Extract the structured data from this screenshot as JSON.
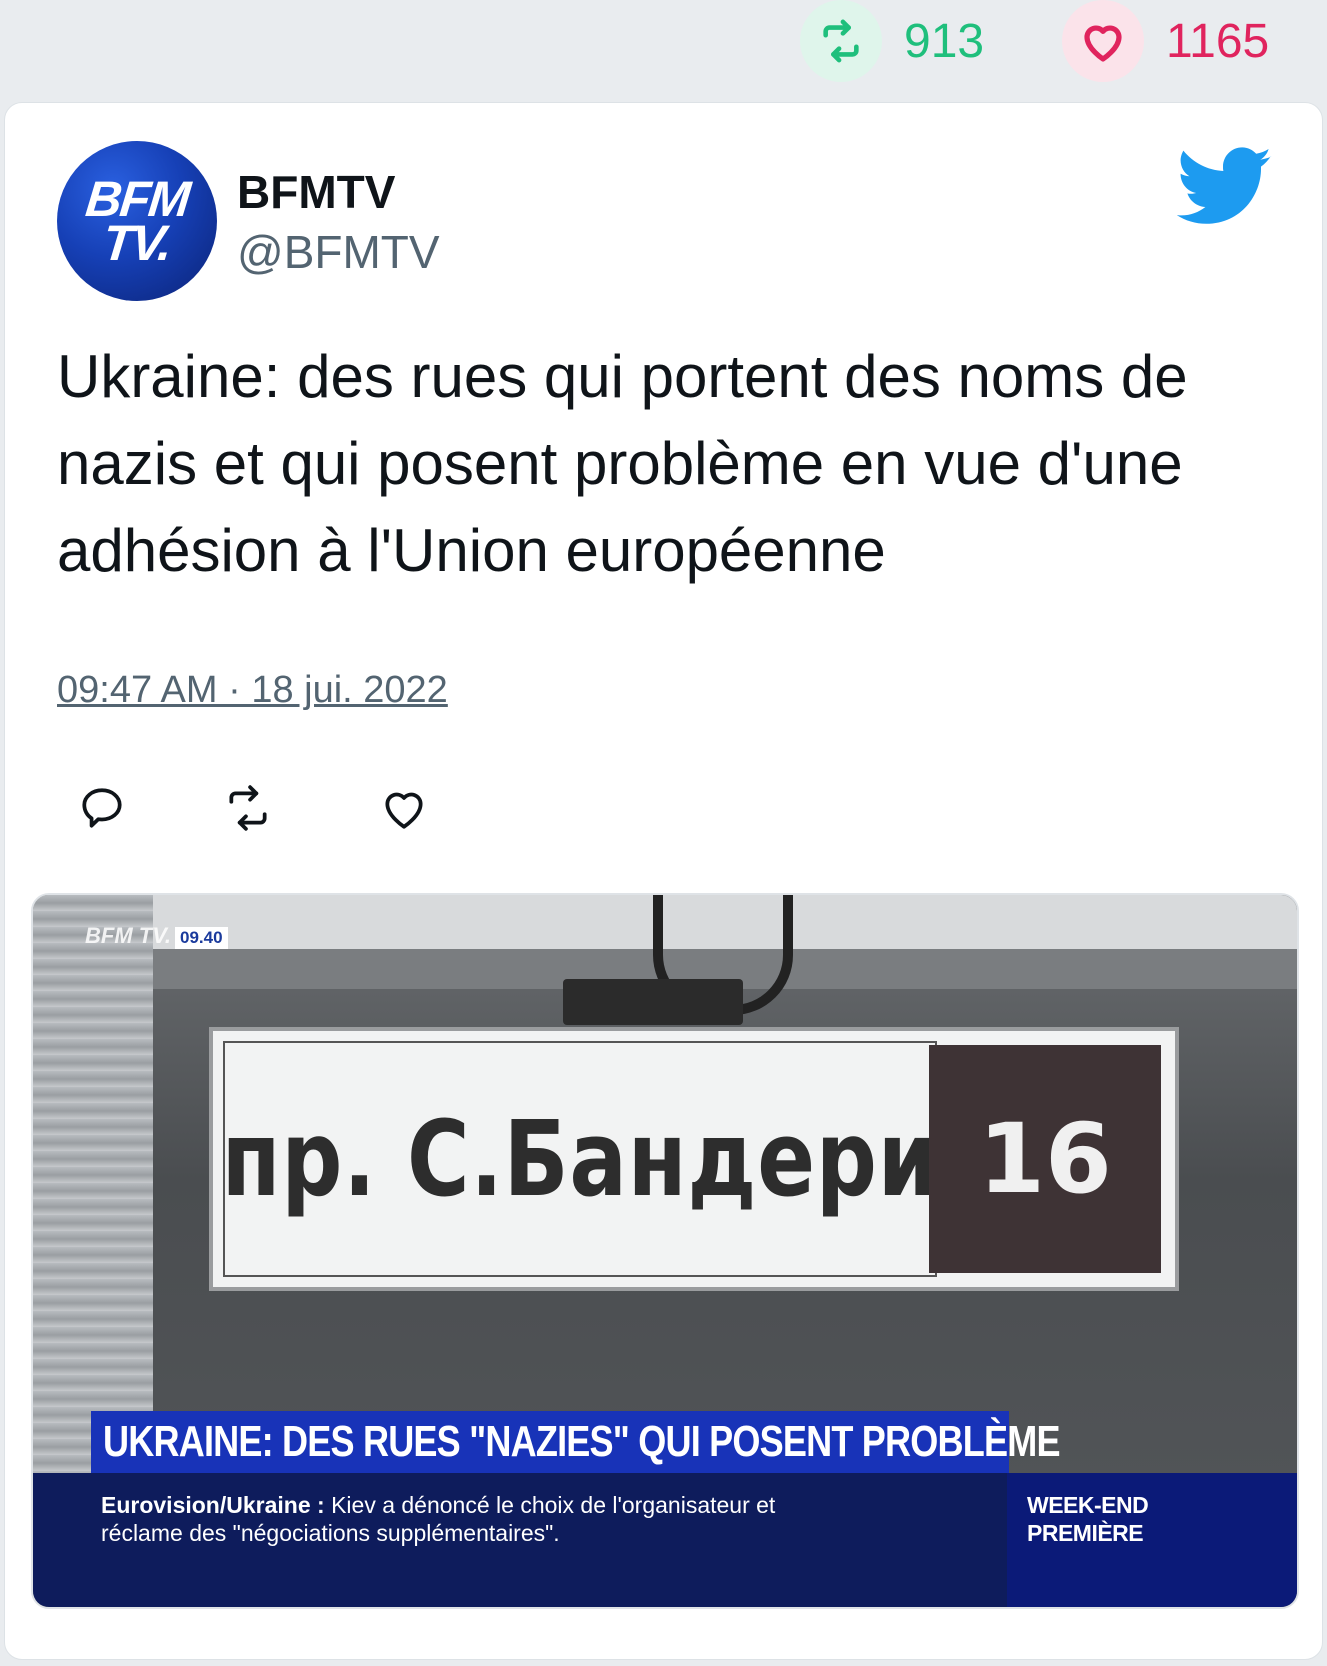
{
  "stats": {
    "retweets": "913",
    "likes": "1165",
    "retweet_icon": "retweet-icon",
    "like_icon": "heart-icon",
    "retweet_color": "#1fbf7c",
    "like_color": "#e0245e"
  },
  "tweet": {
    "author_name": "BFMTV",
    "author_handle": "@BFMTV",
    "avatar_text_1": "BFM",
    "avatar_text_2": "TV.",
    "text": "Ukraine: des rues qui portent des noms de nazis et qui posent problème en vue d'une adhésion à l'Union européenne",
    "date": "09:47 AM · 18 jui. 2022",
    "brand_color": "#1d9bf0",
    "actions": [
      "reply-icon",
      "retweet-icon",
      "like-icon"
    ]
  },
  "media": {
    "logo_text": "BFM TV.",
    "clock": "09.40",
    "sign_street": "пр. С.Бандери",
    "sign_number": "16",
    "headline": "UKRAINE: DES RUES \"NAZIES\" QUI POSENT PROBLÈME",
    "ticker_topic": "Eurovision/Ukraine",
    "ticker_sep": " : ",
    "ticker_line1": "Kiev a dénoncé le choix de l'organisateur et",
    "ticker_line2": "réclame des \"négociations supplémentaires\".",
    "show_line1": "WEEK-END",
    "show_line2": "PREMIÈRE"
  }
}
